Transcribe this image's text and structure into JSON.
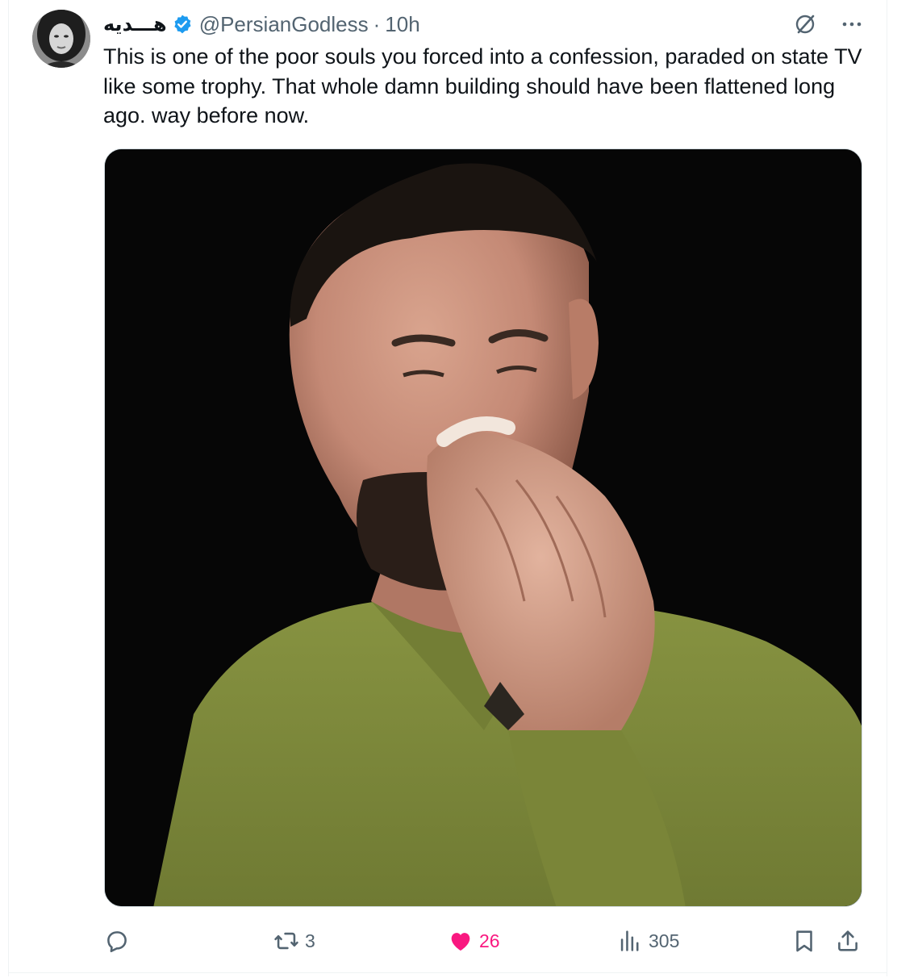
{
  "tweet": {
    "author": {
      "display_name": "هـــديه",
      "handle": "@PersianGodless",
      "verified": true,
      "avatar_icon": "avatar-photo"
    },
    "separator": "·",
    "time": "10h",
    "text": "This is one of the poor souls you forced into a confession, paraded on state TV like some trophy. That whole damn building should have been flattened long ago. way before now.",
    "media": {
      "type": "video-thumbnail",
      "icon": "video-still"
    },
    "top_icons": [
      "grok-icon",
      "more-icon"
    ],
    "metrics": {
      "replies": "",
      "reposts": "3",
      "likes": "26",
      "views": "305"
    },
    "colors": {
      "accent_blue": "#1d9bf0",
      "like_pink": "#f91880",
      "muted_text": "#536471",
      "shirt_green": "#7d8a3c"
    }
  }
}
